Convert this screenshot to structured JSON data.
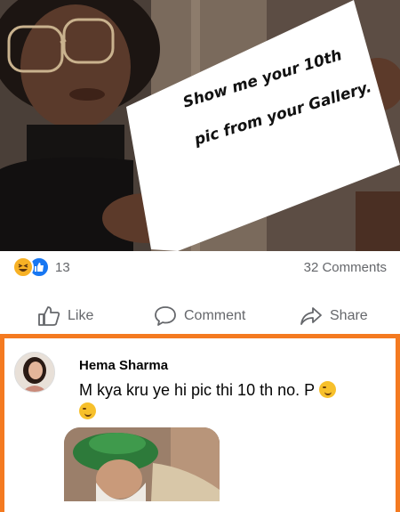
{
  "post": {
    "sign_line1": "Show me your 10th",
    "sign_line2": "pic from your Gallery."
  },
  "reactions": {
    "icons": [
      "haha-emoji",
      "like-emoji"
    ],
    "count": "13",
    "comments": "32 Comments"
  },
  "actions": {
    "like": "Like",
    "comment": "Comment",
    "share": "Share"
  },
  "comment": {
    "author": "Hema Sharma",
    "text": "M kya kru ye hi pic thi 10 th no. P",
    "highlight_color": "#f47a20"
  },
  "colors": {
    "like_blue": "#1877f2",
    "muted_text": "#65676b",
    "haha_yellow": "#f7b125"
  }
}
